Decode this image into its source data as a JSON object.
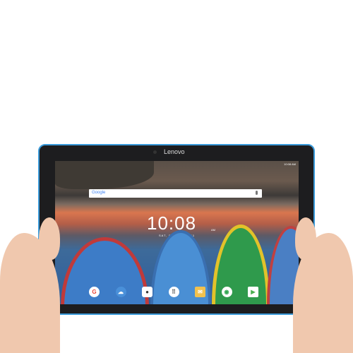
{
  "device": {
    "brand": "Lenovo"
  },
  "screen": {
    "search_label": "Google",
    "status_time": "10:08 AM",
    "clock": "10:08",
    "ampm": "AM",
    "date": "SAT, DEC 24, 2011",
    "dock": [
      {
        "icon": "google-icon",
        "glyph": "G"
      },
      {
        "icon": "cloud-icon",
        "glyph": "☁"
      },
      {
        "icon": "camera-icon",
        "glyph": "●"
      },
      {
        "icon": "apps-icon",
        "glyph": "⠿"
      },
      {
        "icon": "email-icon",
        "glyph": "✉"
      },
      {
        "icon": "chrome-icon",
        "glyph": "◉"
      },
      {
        "icon": "play-store-icon",
        "glyph": "▶"
      }
    ]
  },
  "colors": {
    "bezel_edge": "#3a9ad9",
    "skin": "#f0c8ae"
  }
}
